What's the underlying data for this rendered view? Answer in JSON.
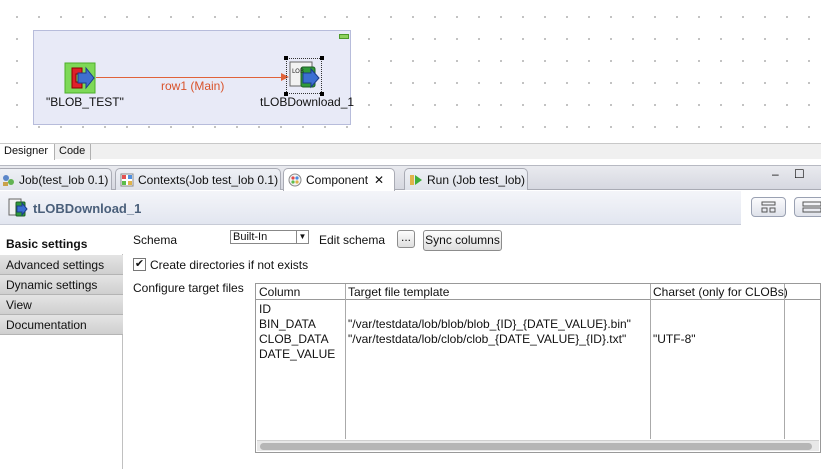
{
  "canvas": {
    "input_component_label": "\"BLOB_TEST\"",
    "link_label": "row1 (Main)",
    "lob_component_label": "tLOBDownload_1",
    "lob_icon_text": "LOB"
  },
  "designer_tabs": [
    "Designer",
    "Code"
  ],
  "view_tabs": [
    {
      "label": "Job(test_lob 0.1)",
      "icon": "job-icon"
    },
    {
      "label": "Contexts(Job test_lob 0.1)",
      "icon": "contexts-icon"
    },
    {
      "label": "Component",
      "icon": "component-icon",
      "close": "✕"
    },
    {
      "label": "Run (Job test_lob)",
      "icon": "run-icon"
    }
  ],
  "window_controls": {
    "minimize": "–",
    "maximize": "☐"
  },
  "component_header": {
    "title": "tLOBDownload_1"
  },
  "side_tabs": [
    "Basic settings",
    "Advanced settings",
    "Dynamic settings",
    "View",
    "Documentation"
  ],
  "form": {
    "schema_label": "Schema",
    "schema_value": "Built-In",
    "edit_schema_label": "Edit schema",
    "edit_schema_button": "...",
    "sync_columns_button": "Sync columns",
    "create_dirs_label": "Create directories if not exists",
    "create_dirs_checked": "✔",
    "configure_label": "Configure target files"
  },
  "table": {
    "columns": [
      "Column",
      "Target file template",
      "Charset (only for CLOBs)"
    ],
    "rows": [
      {
        "column": "ID",
        "template": "",
        "charset": ""
      },
      {
        "column": "BIN_DATA",
        "template": "\"/var/testdata/lob/blob/blob_{ID}_{DATE_VALUE}.bin\"",
        "charset": ""
      },
      {
        "column": "CLOB_DATA",
        "template": "\"/var/testdata/lob/clob/clob_{DATE_VALUE}_{ID}.txt\"",
        "charset": "\"UTF-8\""
      },
      {
        "column": "DATE_VALUE",
        "template": "",
        "charset": ""
      }
    ]
  },
  "colors": {
    "accent_link": "#e0623a",
    "header_title": "#4a5f7a"
  }
}
